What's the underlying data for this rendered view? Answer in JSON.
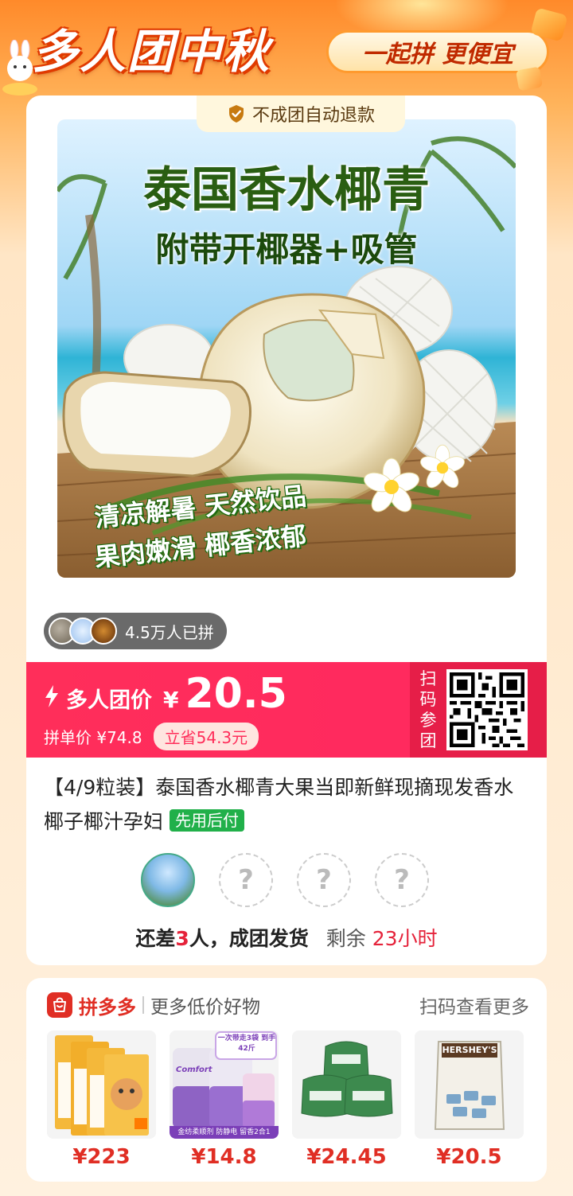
{
  "banner": {
    "title": "多人团中秋",
    "slogan": "一起拼 更便宜"
  },
  "refund_badge": "不成团自动退款",
  "product_image": {
    "title": "泰国香水椰青",
    "subtitle": "附带开椰器+吸管",
    "tag1": "清凉解暑 天然饮品",
    "tag2": "果肉嫩滑 椰香浓郁"
  },
  "joined": "4.5万人已拼",
  "price": {
    "group_label": "多人团价",
    "currency": "¥",
    "group_price": "20.5",
    "single_label": "拼单价 ¥74.8",
    "save_label": "立省54.3元",
    "scan_label": "扫码参团"
  },
  "product": {
    "title": "【4/9粒装】泰国香水椰青大果当即新鲜现摘现发香水椰子椰汁孕妇",
    "pay_later": "先用后付"
  },
  "group_status": {
    "prefix": "还差",
    "count": "3",
    "suffix": "人，成团发货",
    "remaining_label": "剩余",
    "remaining_time": "23小时",
    "empty_slot": "?"
  },
  "more": {
    "brand": "拼多多",
    "label": "更多低价好物",
    "scan": "扫码查看更多",
    "items": [
      {
        "price": "¥223"
      },
      {
        "price": "¥14.8",
        "promo": "一次带走3袋 到手42斤",
        "strip": "金纺柔顺剂 防静电 留香2合1",
        "brand": "Comfort"
      },
      {
        "price": "¥24.45"
      },
      {
        "price": "¥20.5",
        "brand": "HERSHEY'S"
      }
    ]
  }
}
